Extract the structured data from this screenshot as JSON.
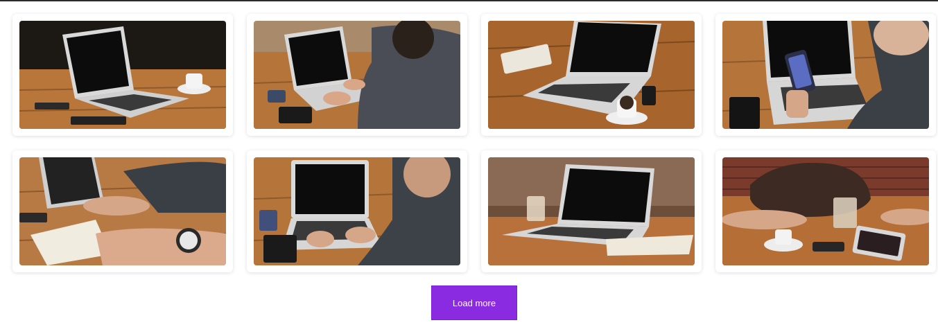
{
  "gallery": {
    "images": [
      {
        "subject": "laptop-with-coffee-on-table"
      },
      {
        "subject": "person-typing-on-laptop"
      },
      {
        "subject": "laptop-notebook-coffee"
      },
      {
        "subject": "person-holding-phone-at-laptop"
      },
      {
        "subject": "person-writing-in-notebook"
      },
      {
        "subject": "person-typing-on-laptop-front"
      },
      {
        "subject": "laptop-with-glass-of-water"
      },
      {
        "subject": "people-meeting-with-tablet"
      }
    ]
  },
  "load_more_label": "Load more",
  "colors": {
    "accent": "#8a2be2",
    "wood": "#b8763a",
    "dark_bg": "#1f1a16"
  }
}
